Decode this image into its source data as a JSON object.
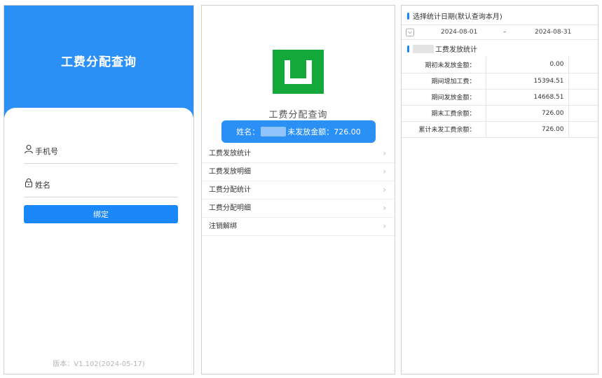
{
  "login": {
    "title": "工费分配查询",
    "phone_label": "手机号",
    "name_label": "姓名",
    "bind_button": "绑定",
    "version": "版本：V1.102(2024-05-17)"
  },
  "home": {
    "app_name": "工费分配查询",
    "info": {
      "name_prefix": "姓名：",
      "unpaid_label": "未发放金额：726.00"
    },
    "menu": [
      {
        "label": "工费发放统计"
      },
      {
        "label": "工费发放明细"
      },
      {
        "label": "工费分配统计"
      },
      {
        "label": "工费分配明细"
      },
      {
        "label": "注销解绑"
      }
    ]
  },
  "stats": {
    "date_section_title": "选择统计日期(默认查询本月)",
    "start_date": "2024-08-01",
    "separator": "–",
    "end_date": "2024-08-31",
    "section_title": "工费发放统计",
    "rows": [
      {
        "label": "期初未发放金额：",
        "value": "0.00"
      },
      {
        "label": "期间增加工费：",
        "value": "15394.51"
      },
      {
        "label": "期间发放金额：",
        "value": "14668.51"
      },
      {
        "label": "期末工费余额：",
        "value": "726.00"
      },
      {
        "label": "累计未发工费余额：",
        "value": "726.00"
      }
    ]
  },
  "colors": {
    "primary": "#2a90f6",
    "button": "#1a86f8",
    "logo": "#14a83a"
  }
}
